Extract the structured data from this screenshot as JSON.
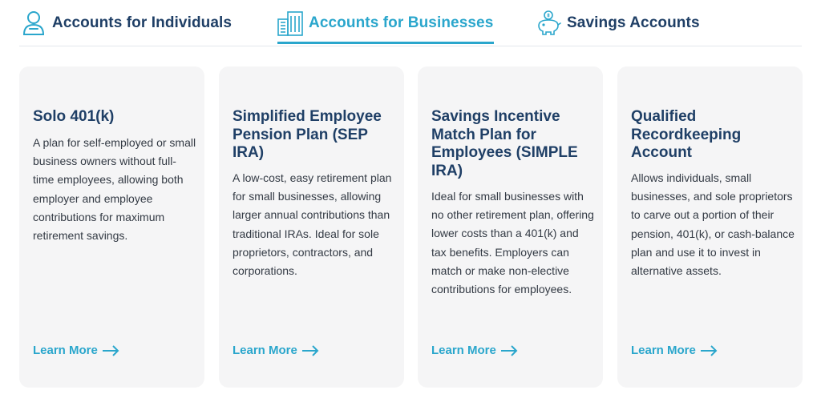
{
  "tabs": [
    {
      "label": "Accounts for Individuals",
      "icon": "person-icon",
      "active": false
    },
    {
      "label": "Accounts for Businesses",
      "icon": "building-icon",
      "active": true
    },
    {
      "label": "Savings Accounts",
      "icon": "piggy-bank-icon",
      "active": false
    }
  ],
  "colors": {
    "accent": "#2aa6cc",
    "heading": "#1f3f66",
    "card_bg": "#f5f5f6",
    "text": "#333a44"
  },
  "cards": [
    {
      "title": "Solo 401(k)",
      "description": "A plan for self-employed or small business owners without full-time employees, allowing both employer and employee contributions for maximum retirement savings.",
      "link": "Learn More"
    },
    {
      "title": "Simplified Employee Pension Plan (SEP IRA)",
      "description": "A low-cost, easy retirement plan for small businesses, allowing larger annual contributions than traditional IRAs. Ideal for sole proprietors, contractors, and corporations.",
      "link": "Learn More"
    },
    {
      "title": "Savings Incentive Match Plan for Employees (SIMPLE IRA)",
      "description": "Ideal for small businesses with no other retirement plan, offering lower costs than a 401(k) and tax benefits. Employers can match or make non-elective contributions for employees.",
      "link": "Learn More"
    },
    {
      "title": "Qualified Recordkeeping Account",
      "description": "Allows individuals, small businesses, and sole proprietors to carve out a portion of their pension, 401(k), or cash-balance plan and use it to invest in alternative assets.",
      "link": "Learn More"
    }
  ]
}
